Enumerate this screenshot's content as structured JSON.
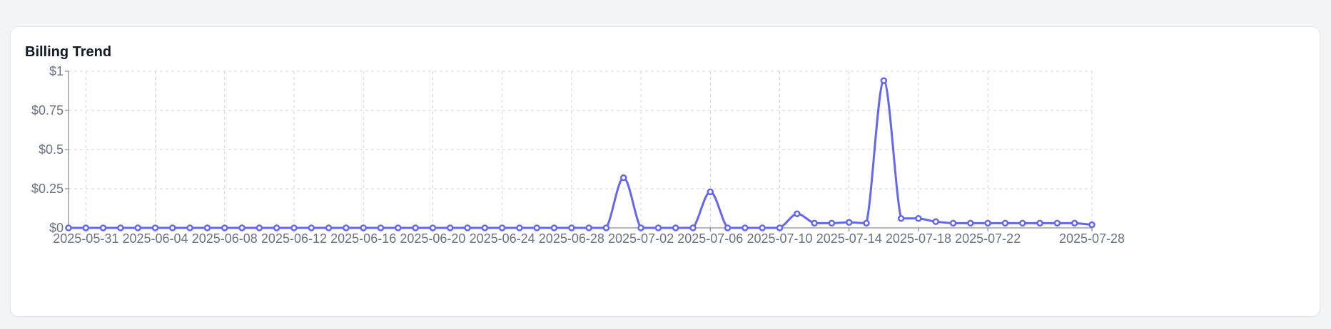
{
  "card": {
    "title": "Billing Trend"
  },
  "chart_data": {
    "type": "line",
    "title": "Billing Trend",
    "xlabel": "",
    "ylabel": "",
    "ylim": [
      0,
      1
    ],
    "yticks": [
      0,
      0.25,
      0.5,
      0.75,
      1
    ],
    "ytick_labels": [
      "$0",
      "$0.25",
      "$0.5",
      "$0.75",
      "$1"
    ],
    "xtick_labels": [
      "2025-05-31",
      "2025-06-04",
      "2025-06-08",
      "2025-06-12",
      "2025-06-16",
      "2025-06-20",
      "2025-06-24",
      "2025-06-28",
      "2025-07-02",
      "2025-07-06",
      "2025-07-10",
      "2025-07-14",
      "2025-07-18",
      "2025-07-22",
      "2025-07-28"
    ],
    "grid": true,
    "smooth": true,
    "color": "#6366f1",
    "x": [
      "2025-05-30",
      "2025-05-31",
      "2025-06-01",
      "2025-06-02",
      "2025-06-03",
      "2025-06-04",
      "2025-06-05",
      "2025-06-06",
      "2025-06-07",
      "2025-06-08",
      "2025-06-09",
      "2025-06-10",
      "2025-06-11",
      "2025-06-12",
      "2025-06-13",
      "2025-06-14",
      "2025-06-15",
      "2025-06-16",
      "2025-06-17",
      "2025-06-18",
      "2025-06-19",
      "2025-06-20",
      "2025-06-21",
      "2025-06-22",
      "2025-06-23",
      "2025-06-24",
      "2025-06-25",
      "2025-06-26",
      "2025-06-27",
      "2025-06-28",
      "2025-06-29",
      "2025-06-30",
      "2025-07-01",
      "2025-07-02",
      "2025-07-03",
      "2025-07-04",
      "2025-07-05",
      "2025-07-06",
      "2025-07-07",
      "2025-07-08",
      "2025-07-09",
      "2025-07-10",
      "2025-07-11",
      "2025-07-12",
      "2025-07-13",
      "2025-07-14",
      "2025-07-15",
      "2025-07-16",
      "2025-07-17",
      "2025-07-18",
      "2025-07-19",
      "2025-07-20",
      "2025-07-21",
      "2025-07-22",
      "2025-07-23",
      "2025-07-24",
      "2025-07-25",
      "2025-07-26",
      "2025-07-27",
      "2025-07-28"
    ],
    "series": [
      {
        "values": [
          0,
          0,
          0,
          0,
          0,
          0,
          0,
          0,
          0,
          0,
          0,
          0,
          0,
          0,
          0,
          0,
          0,
          0,
          0,
          0,
          0,
          0,
          0,
          0,
          0,
          0,
          0,
          0,
          0,
          0,
          0,
          0,
          0.32,
          0,
          0,
          0,
          0,
          0.23,
          0,
          0,
          0,
          0,
          0.09,
          0.03,
          0.03,
          0.035,
          0.03,
          0.94,
          0.06,
          0.06,
          0.04,
          0.03,
          0.03,
          0.03,
          0.03,
          0.03,
          0.03,
          0.03,
          0.03,
          0.02
        ]
      }
    ]
  }
}
